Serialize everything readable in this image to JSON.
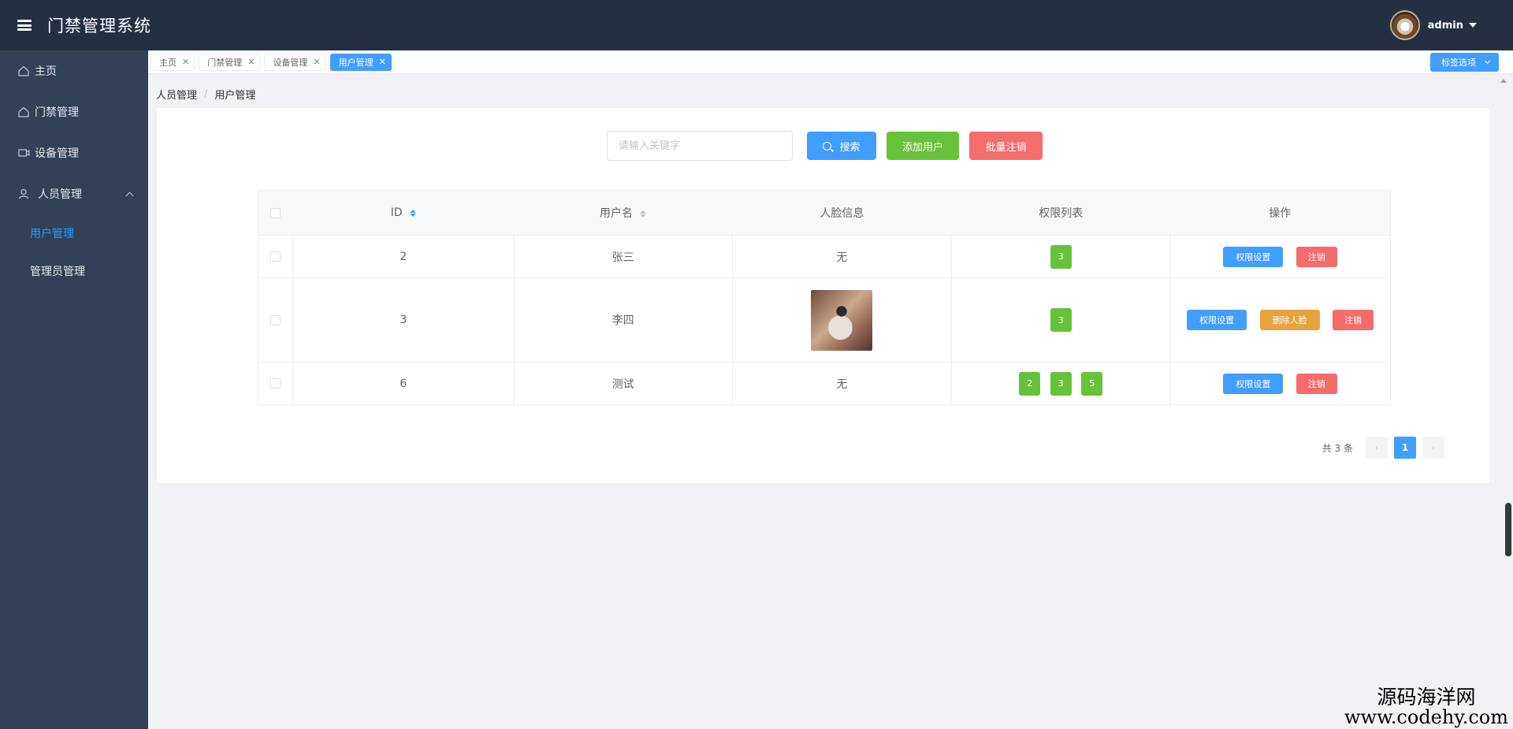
{
  "header": {
    "title": "门禁管理系统",
    "username": "admin"
  },
  "sidebar": {
    "items": [
      {
        "label": "主页"
      },
      {
        "label": "门禁管理"
      },
      {
        "label": "设备管理"
      },
      {
        "label": "人员管理"
      }
    ],
    "sub_items": [
      {
        "label": "用户管理"
      },
      {
        "label": "管理员管理"
      }
    ]
  },
  "tabs": [
    {
      "label": "主页"
    },
    {
      "label": "门禁管理"
    },
    {
      "label": "设备管理"
    },
    {
      "label": "用户管理"
    }
  ],
  "tag_options_label": "标签选项",
  "breadcrumb": {
    "level1": "人员管理",
    "level2": "用户管理",
    "separator": "/"
  },
  "toolbar": {
    "search_placeholder": "请输入关键字",
    "search_label": "搜索",
    "add_label": "添加用户",
    "batch_label": "批量注销"
  },
  "table": {
    "headers": {
      "id": "ID",
      "username": "用户名",
      "face": "人脸信息",
      "permissions": "权限列表",
      "actions": "操作"
    },
    "rows": [
      {
        "id": "2",
        "name": "张三",
        "face": "无",
        "perms": [
          "3"
        ],
        "actions": [
          "权限设置",
          "注销"
        ]
      },
      {
        "id": "3",
        "name": "李四",
        "face": "",
        "perms": [
          "3"
        ],
        "actions": [
          "权限设置",
          "删除人脸",
          "注销"
        ]
      },
      {
        "id": "6",
        "name": "测试",
        "face": "无",
        "perms": [
          "2",
          "3",
          "5"
        ],
        "actions": [
          "权限设置",
          "注销"
        ]
      }
    ]
  },
  "pagination": {
    "total_text": "共 3 条",
    "current_page": "1",
    "prev": "‹",
    "next": "›"
  },
  "watermark": {
    "line1": "源码海洋网",
    "line2": "www.codehy.com"
  },
  "colors": {
    "header_bg": "#242f42",
    "sidebar_bg": "#324157",
    "primary": "#409eff",
    "success": "#67c23a",
    "danger": "#f56c6c",
    "warning": "#e6a23c"
  }
}
